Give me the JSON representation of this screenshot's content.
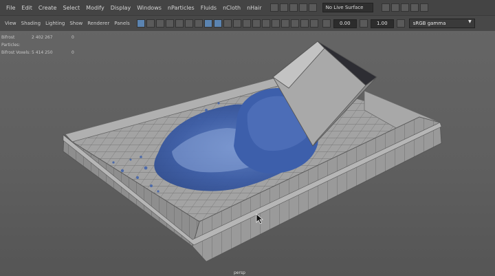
{
  "menu": {
    "items": [
      "File",
      "Edit",
      "Create",
      "Select",
      "Modify",
      "Display",
      "Windows",
      "nParticles",
      "Fluids",
      "nCloth",
      "nHair"
    ],
    "live_surface": "No Live Surface"
  },
  "panel_menu": {
    "items": [
      "View",
      "Shading",
      "Lighting",
      "Show",
      "Renderer",
      "Panels"
    ],
    "exposure": "0.00",
    "gamma": "1.00",
    "color_space": "sRGB gamma"
  },
  "hud": {
    "rows": [
      {
        "label": "Bifrost Particles:",
        "value": "2 402 267",
        "extra": "0"
      },
      {
        "label": "Bifrost Voxels:",
        "value": "5 414 250",
        "extra": "0"
      }
    ]
  },
  "footer": {
    "label": "persp"
  },
  "colors": {
    "water": "#3c5fa8",
    "tank": "#9a9a9a",
    "grid_line": "#6b6b6b",
    "selected_icon": "#5b84b1"
  }
}
